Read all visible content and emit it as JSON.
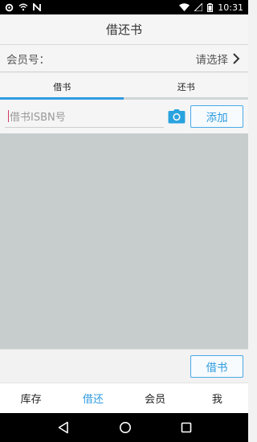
{
  "status_bar": {
    "time": "10:31",
    "left_icons": [
      "settings-icon",
      "wifi-icon",
      "n-notification-icon"
    ],
    "right_icons": [
      "wifi-icon",
      "signal-icon",
      "battery-icon"
    ]
  },
  "title_bar": {
    "title": "借还书"
  },
  "member": {
    "label": "会员号：",
    "select_text": "请选择"
  },
  "tabs": [
    {
      "label": "借书",
      "active": true
    },
    {
      "label": "还书",
      "active": false
    }
  ],
  "isbn_input": {
    "placeholder": "借书ISBN号",
    "value": ""
  },
  "buttons": {
    "add": "添加",
    "borrow": "借书"
  },
  "bottom_nav": [
    {
      "label": "库存",
      "active": false
    },
    {
      "label": "借还",
      "active": true
    },
    {
      "label": "会员",
      "active": false
    },
    {
      "label": "我",
      "active": false
    }
  ],
  "colors": {
    "accent": "#2f9be0",
    "list_bg": "#c7cdcd"
  }
}
